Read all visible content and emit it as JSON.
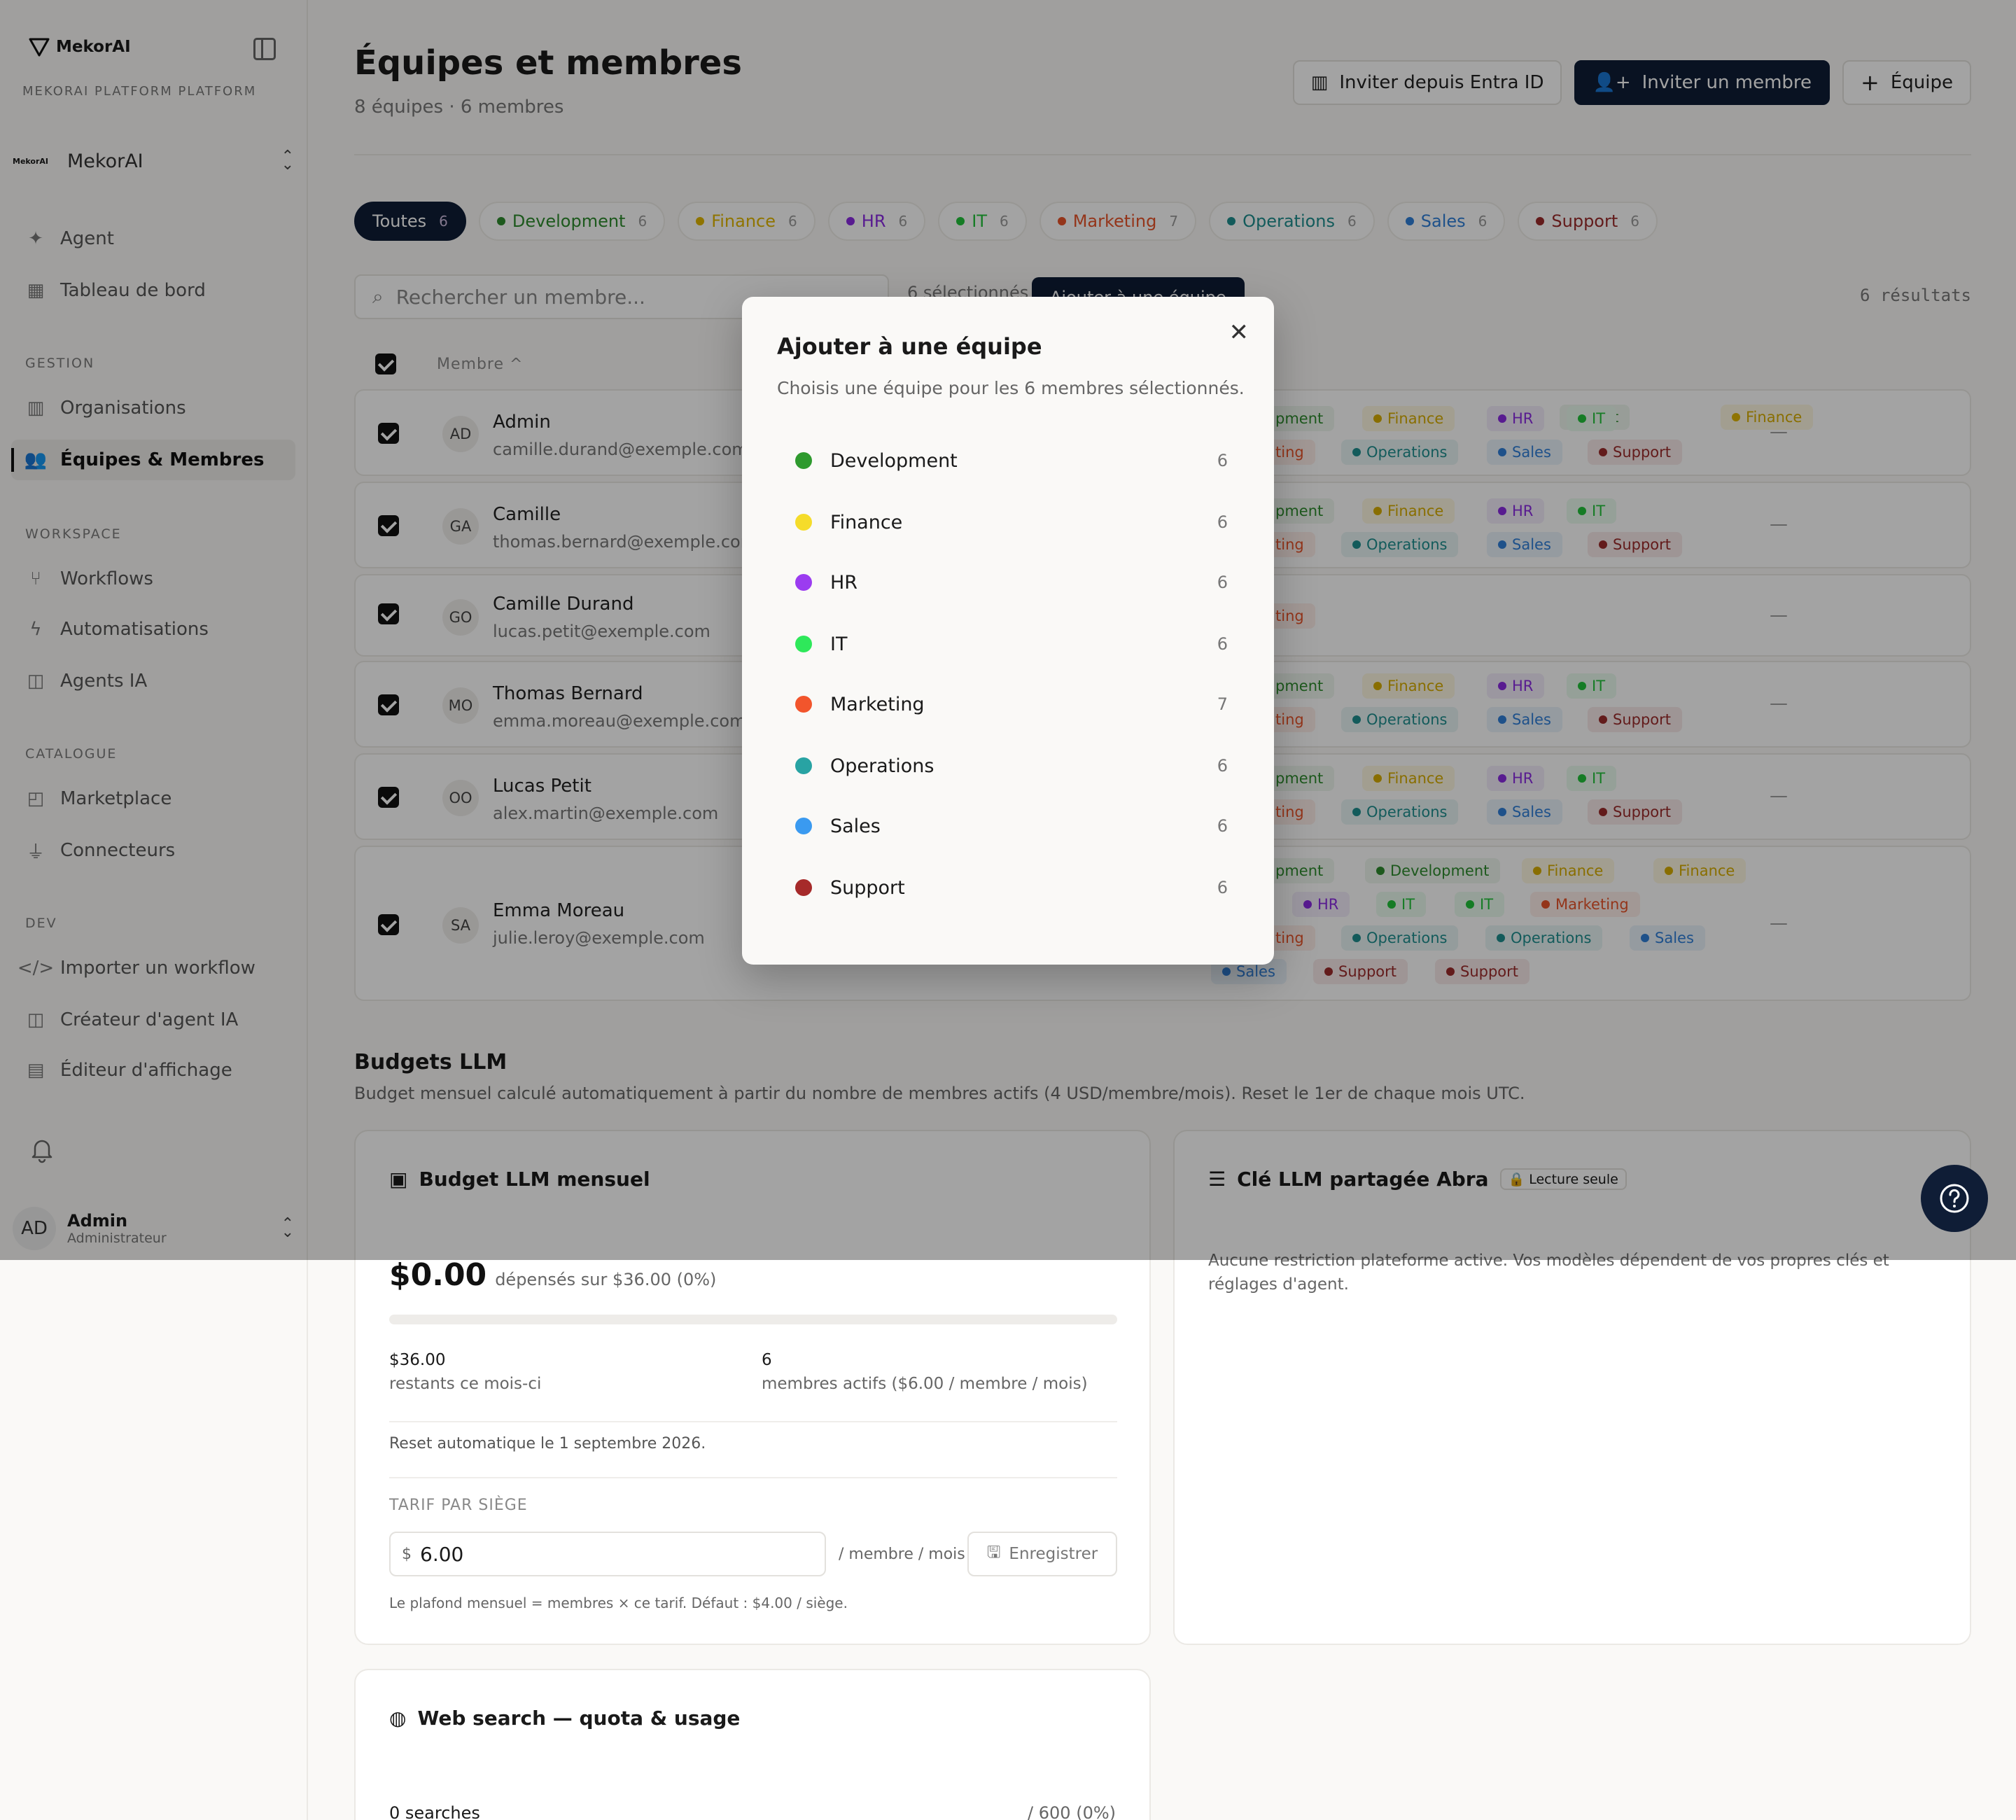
{
  "brand": {
    "logo_text": "MekorAI",
    "platform": "MEKORAI PLATFORM PLATFORM",
    "org_mini": "MekorAI",
    "org_name": "MekorAI"
  },
  "sidebar": {
    "top_items": [
      {
        "label": "Agent",
        "icon": "sparkle-icon"
      },
      {
        "label": "Tableau de bord",
        "icon": "dashboard-icon"
      }
    ],
    "sections": [
      {
        "title": "GESTION",
        "items": [
          {
            "label": "Organisations",
            "icon": "building-icon"
          },
          {
            "label": "Équipes & Membres",
            "icon": "users-icon",
            "active": true
          }
        ]
      },
      {
        "title": "WORKSPACE",
        "items": [
          {
            "label": "Workflows",
            "icon": "workflow-icon"
          },
          {
            "label": "Automatisations",
            "icon": "bolt-icon"
          },
          {
            "label": "Agents IA",
            "icon": "bot-icon"
          }
        ]
      },
      {
        "title": "CATALOGUE",
        "items": [
          {
            "label": "Marketplace",
            "icon": "shop-icon"
          },
          {
            "label": "Connecteurs",
            "icon": "plug-icon"
          }
        ]
      },
      {
        "title": "DEV",
        "items": [
          {
            "label": "Importer un workflow",
            "icon": "code-icon"
          },
          {
            "label": "Créateur d'agent IA",
            "icon": "bot-icon"
          },
          {
            "label": "Éditeur d'affichage",
            "icon": "layout-icon"
          }
        ]
      }
    ],
    "user": {
      "initials": "AD",
      "name": "Admin",
      "role": "Administrateur"
    }
  },
  "header": {
    "title": "Équipes et membres",
    "subtitle": "8 équipes · 6 membres",
    "btn_entra": "Inviter depuis Entra ID",
    "btn_invite": "Inviter un membre",
    "btn_team": "Équipe"
  },
  "filters": [
    {
      "label": "Toutes",
      "count": "6",
      "active": true
    },
    {
      "label": "Development",
      "count": "6",
      "color": "#2e8b2e"
    },
    {
      "label": "Finance",
      "count": "6",
      "color": "#e0b600"
    },
    {
      "label": "HR",
      "count": "6",
      "color": "#8a2be2"
    },
    {
      "label": "IT",
      "count": "6",
      "color": "#22c33a"
    },
    {
      "label": "Marketing",
      "count": "7",
      "color": "#e8542a"
    },
    {
      "label": "Operations",
      "count": "6",
      "color": "#1f8f8f"
    },
    {
      "label": "Sales",
      "count": "6",
      "color": "#2f7fd8"
    },
    {
      "label": "Support",
      "count": "6",
      "color": "#9b2b2b"
    }
  ],
  "toolbar": {
    "search_placeholder": "Rechercher un membre...",
    "selected": "6 sélectionnés",
    "add_to_team": "Ajouter à une équipe",
    "results": "6 résultats"
  },
  "table": {
    "col_member": "Membre ^",
    "rows": [
      {
        "initials": "AD",
        "name": "Admin",
        "email": "camille.durand@exemple.com",
        "status": "—"
      },
      {
        "initials": "GA",
        "name": "Camille",
        "email": "thomas.bernard@exemple.com",
        "status": "—"
      },
      {
        "initials": "GO",
        "name": "Camille Durand",
        "email": "lucas.petit@exemple.com",
        "status": "—"
      },
      {
        "initials": "MO",
        "name": "Thomas Bernard",
        "email": "emma.moreau@exemple.com",
        "status": "—"
      },
      {
        "initials": "OO",
        "name": "Lucas Petit",
        "email": "alex.martin@exemple.com",
        "status": "—"
      },
      {
        "initials": "SA",
        "name": "Emma Moreau",
        "email": "julie.leroy@exemple.com",
        "status": "—"
      }
    ]
  },
  "tag_labels": {
    "dev_cut": "pment",
    "mkt_cut": "ting",
    "development": "Development",
    "finance": "Finance",
    "hr": "HR",
    "it": "IT",
    "marketing": "Marketing",
    "operations": "Operations",
    "sales": "Sales",
    "support": "Support"
  },
  "budgets": {
    "title": "Budgets LLM",
    "desc": "Budget mensuel calculé automatiquement à partir du nombre de membres actifs (4 USD/membre/mois). Reset le 1er de chaque mois UTC.",
    "monthly": {
      "title": "Budget LLM mensuel",
      "spent": "$0.00",
      "spent_of": "dépensés sur $36.00 (0%)",
      "progress_fraction": 0,
      "remaining": "$36.00",
      "remaining_label": "restants ce mois-ci",
      "members": "6",
      "members_label": "membres actifs ($6.00 / membre / mois)",
      "reset": "Reset automatique le 1 septembre 2026.",
      "seat_label": "TARIF PAR SIÈGE",
      "currency": "$",
      "seat_value": "6.00",
      "seat_unit": "/ membre / mois",
      "save": "Enregistrer",
      "hint": "Le plafond mensuel = membres × ce tarif. Défaut : $4.00 / siège."
    },
    "shared": {
      "title": "Clé LLM partagée Abra",
      "badge": "Lecture seule",
      "text": "Aucune restriction plateforme active. Vos modèles dépendent de vos propres clés et réglages d'agent."
    },
    "web": {
      "title": "Web search — quota & usage",
      "used": "0 searches",
      "quota": "/ 600 (0%)"
    }
  },
  "modal": {
    "title": "Ajouter à une équipe",
    "desc": "Choisis une équipe pour les 6 membres sélectionnés.",
    "teams": [
      {
        "name": "Development",
        "count": "6",
        "color": "#2e9a2e"
      },
      {
        "name": "Finance",
        "count": "6",
        "color": "#f5dc2a"
      },
      {
        "name": "HR",
        "count": "6",
        "color": "#9b3cf0"
      },
      {
        "name": "IT",
        "count": "6",
        "color": "#2ee85a"
      },
      {
        "name": "Marketing",
        "count": "7",
        "color": "#f2552c"
      },
      {
        "name": "Operations",
        "count": "6",
        "color": "#28a3a3"
      },
      {
        "name": "Sales",
        "count": "6",
        "color": "#3a9af0"
      },
      {
        "name": "Support",
        "count": "6",
        "color": "#a62a2a"
      }
    ]
  }
}
